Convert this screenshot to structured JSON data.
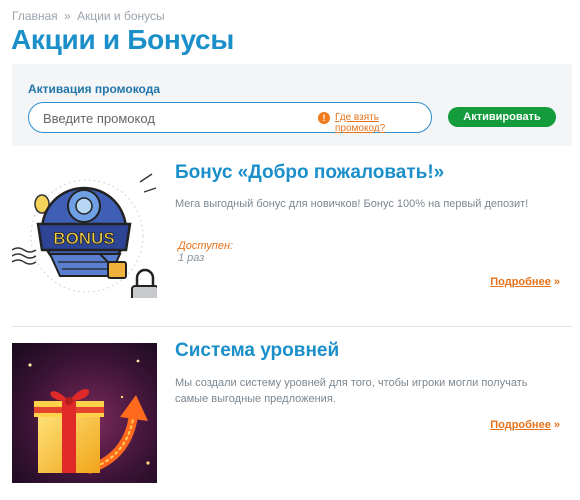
{
  "breadcrumb": {
    "home": "Главная",
    "separator": "»",
    "current": "Акции и бонусы"
  },
  "page": {
    "title": "Акции и Бонусы"
  },
  "promo": {
    "label": "Активация промокода",
    "placeholder": "Введите промокод",
    "help_icon": "info-icon",
    "help_link": "Где взять промокод?",
    "button": "Активировать"
  },
  "cards": [
    {
      "title": "Бонус «Добро пожаловать!»",
      "description": "Мега выгодный бонус для новичков! Бонус 100% на первый депозит!",
      "available_label": "Доступен:",
      "available_value": "1 раз",
      "more": "Подробнее",
      "more_arrow": "»",
      "image_text": "BONUS"
    },
    {
      "title": "Система уровней",
      "description": "Мы создали систему уровней для того, чтобы игроки могли получать самые выгодные предложения.",
      "more": "Подробнее",
      "more_arrow": "»"
    }
  ],
  "colors": {
    "accent": "#1a8fc9",
    "link": "#e8721b",
    "button": "#149b3c",
    "panel": "#f4f5f7"
  }
}
